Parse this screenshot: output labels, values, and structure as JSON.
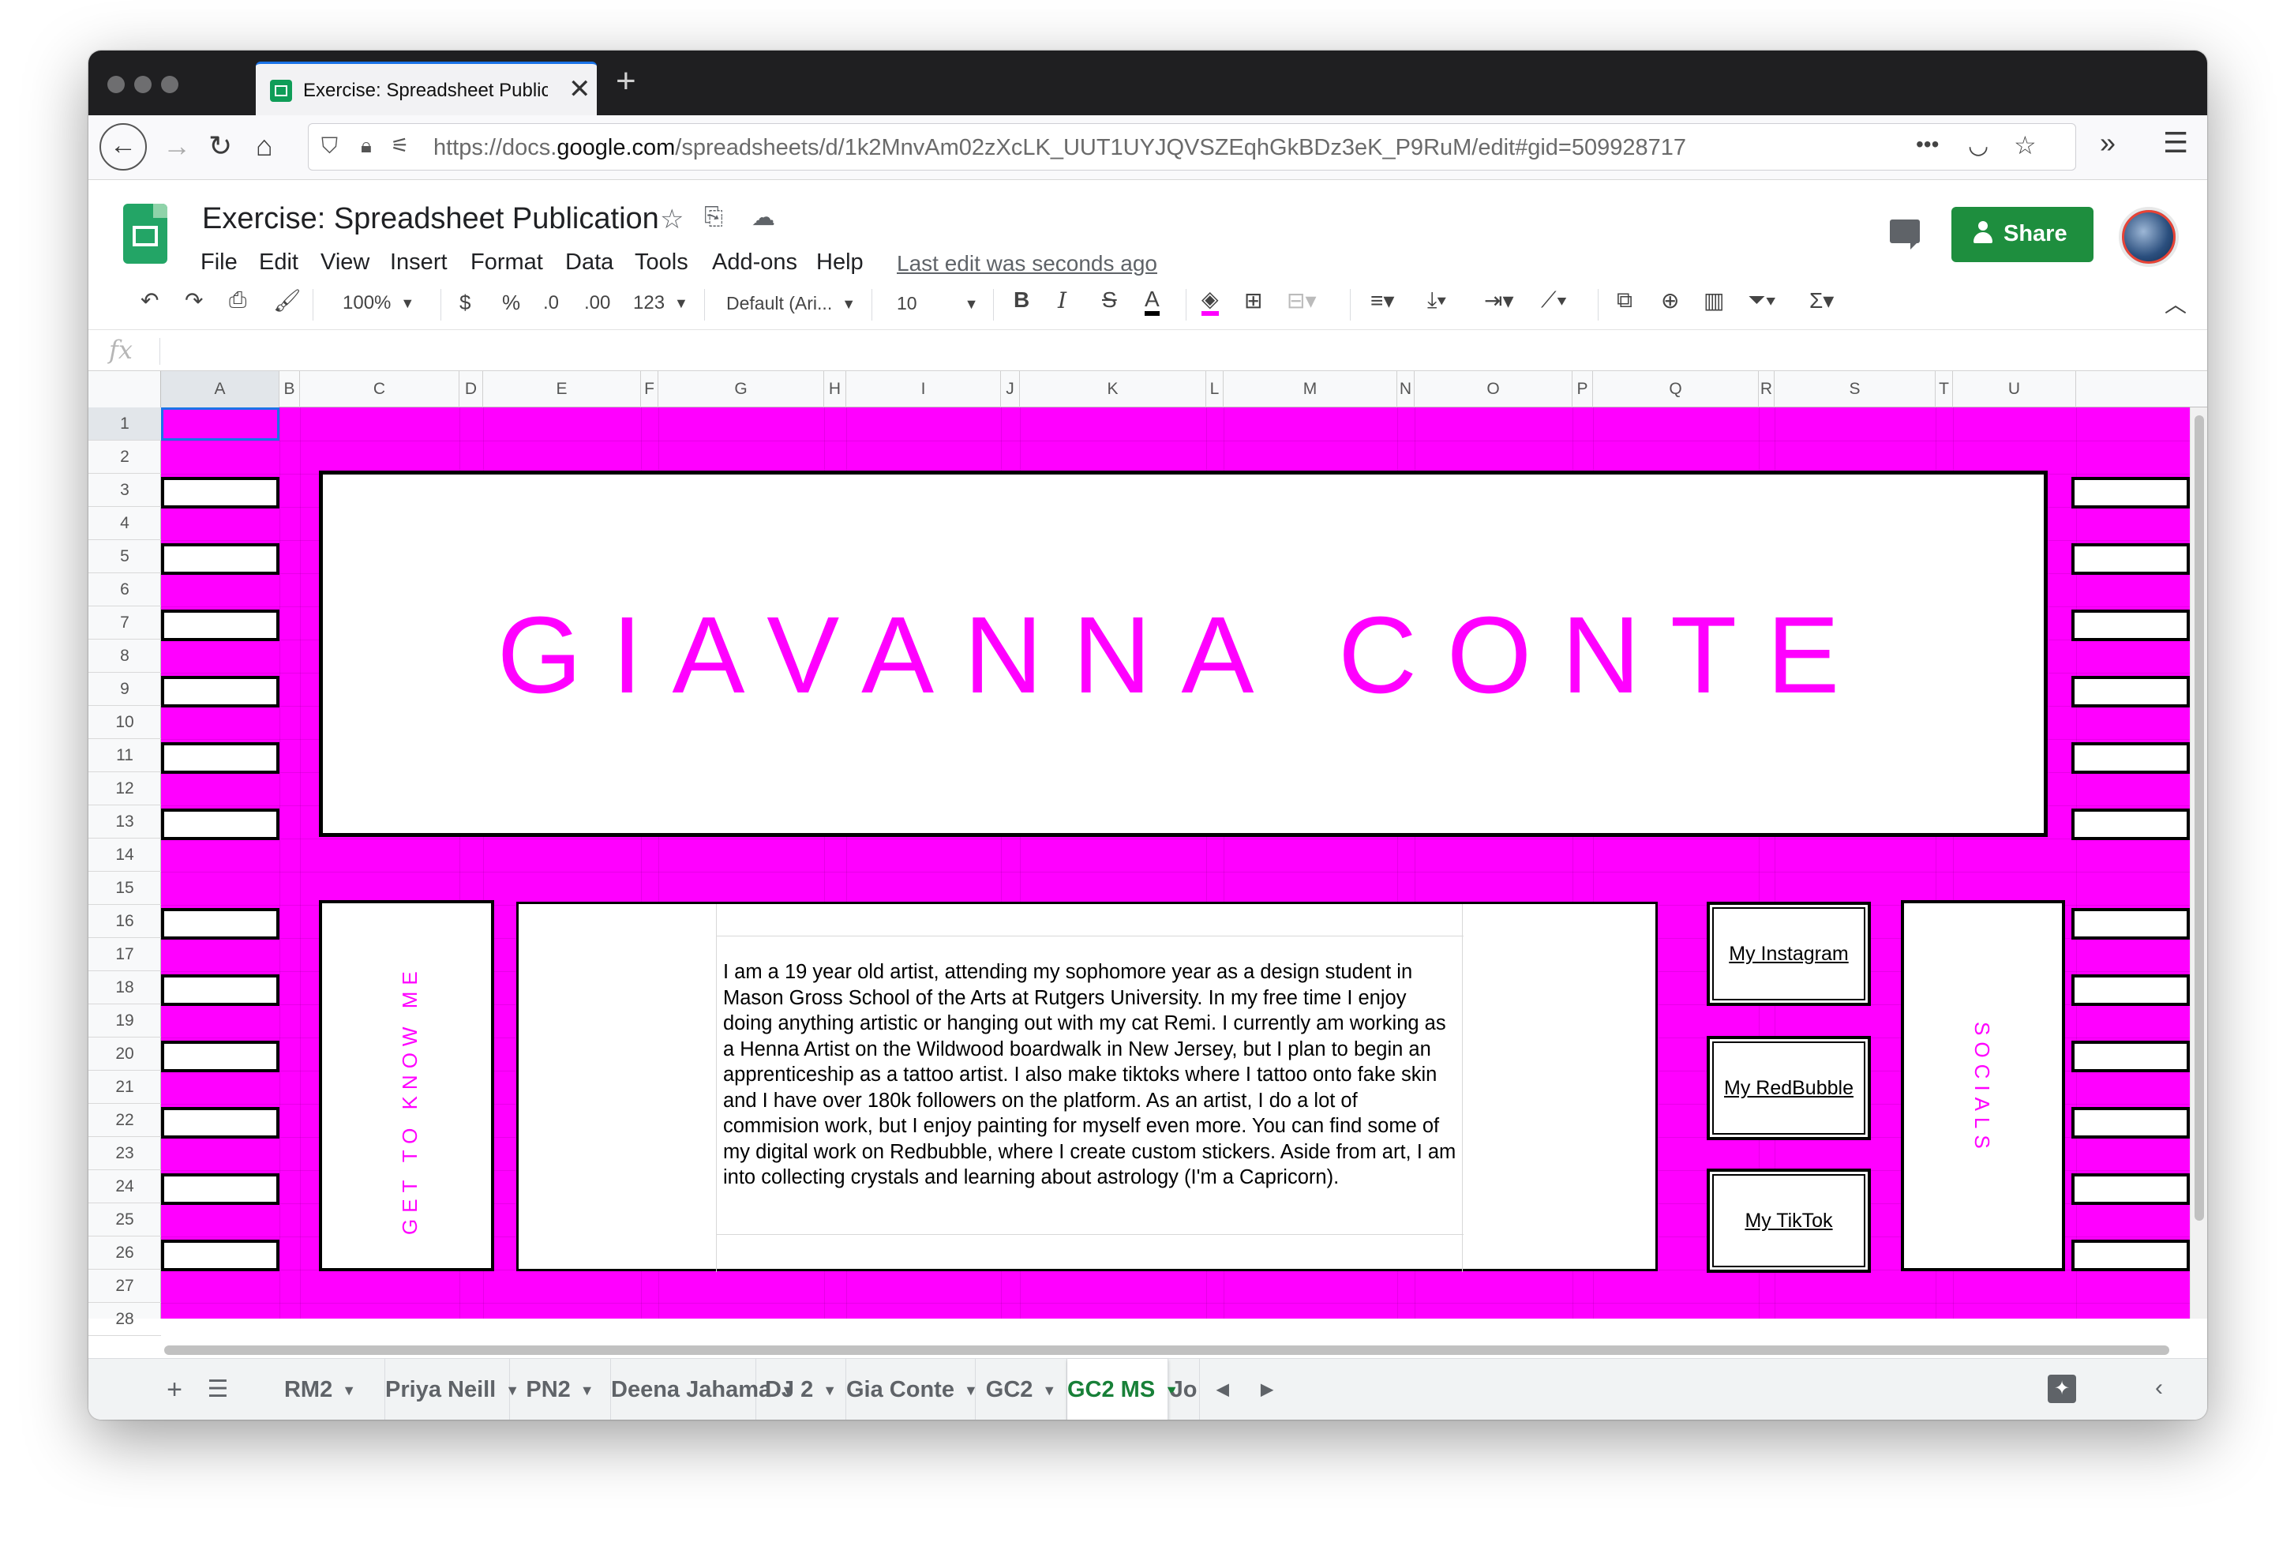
{
  "browser": {
    "tab_title": "Exercise: Spreadsheet Publication",
    "new_tab": "+",
    "url_prefix": "https://docs.",
    "url_domain": "google.com",
    "url_path": "/spreadsheets/d/1k2MnvAm02zXcLK_UUT1UYJQVSZEqhGkBDz3eK_P9RuM/edit#gid=509928717",
    "more": "•••",
    "chevrons": "»"
  },
  "doc": {
    "title": "Exercise: Spreadsheet Publication",
    "menu": [
      "File",
      "Edit",
      "View",
      "Insert",
      "Format",
      "Data",
      "Tools",
      "Add-ons",
      "Help"
    ],
    "last_edit": "Last edit was seconds ago",
    "share_label": "Share"
  },
  "toolbar": {
    "zoom": "100%",
    "currency": "$",
    "percent": "%",
    "dec_less": ".0",
    "dec_more": ".00",
    "number_format": "123",
    "font": "Default (Ari...",
    "font_size": "10",
    "bold": "B",
    "italic": "I",
    "strike": "S",
    "text_color": "A"
  },
  "formula_bar": {
    "fx": "fx",
    "value": ""
  },
  "columns": [
    "A",
    "B",
    "C",
    "D",
    "E",
    "F",
    "G",
    "H",
    "I",
    "J",
    "K",
    "L",
    "M",
    "N",
    "O",
    "P",
    "Q",
    "R",
    "S",
    "T",
    "U"
  ],
  "rows": [
    "1",
    "2",
    "3",
    "4",
    "5",
    "6",
    "7",
    "8",
    "9",
    "10",
    "11",
    "12",
    "13",
    "14",
    "15",
    "16",
    "17",
    "18",
    "19",
    "20",
    "21",
    "22",
    "23",
    "24",
    "25",
    "26",
    "27",
    "28"
  ],
  "content": {
    "name": "GIAVANNA CONTE",
    "left_label": "GET TO KNOW ME",
    "right_label": "SOCIALS",
    "bio": "I am a 19 year old artist, attending my sophomore year as a design student in Mason Gross School of the Arts at Rutgers University. In my free time I enjoy doing anything artistic or hanging out with my cat Remi. I currently am working as a Henna Artist on the Wildwood boardwalk in New Jersey, but I plan to begin an apprenticeship as a tattoo artist. I also make tiktoks where I tattoo onto fake skin and I have over 180k followers on the platform. As an artist, I do a lot of commision work, but I enjoy painting for myself even more. You can find some of my digital work on Redbubble, where I create custom stickers. Aside from art, I am into collecting crystals and learning about astrology (I'm a Capricorn).",
    "links": [
      "My Instagram",
      "My RedBubble",
      "My TikTok"
    ]
  },
  "sheet_tabs": [
    "RM2",
    "Priya Neill",
    "PN2",
    "Deena Jahama",
    "DJ 2",
    "Gia Conte",
    "GC2",
    "GC2 MS",
    "Jo"
  ],
  "active_sheet": "GC2 MS",
  "colors": {
    "accent": "#ff00ff",
    "share": "#1e8e3e",
    "active_tab": "#188038"
  }
}
